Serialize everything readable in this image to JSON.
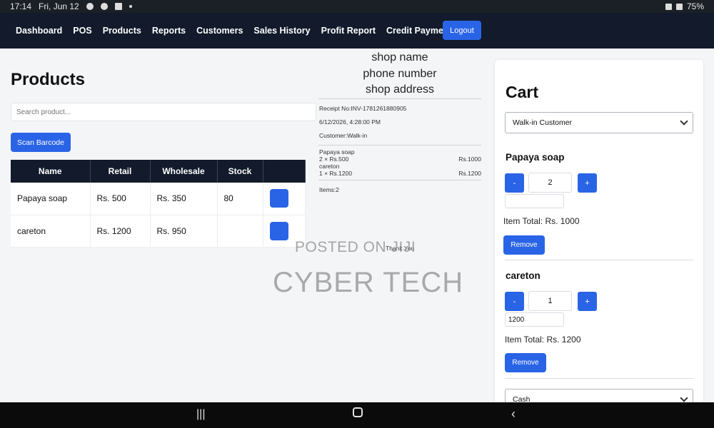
{
  "status_bar": {
    "time": "17:14",
    "date": "Fri, Jun 12",
    "battery": "75%"
  },
  "nav": {
    "items": [
      "Dashboard",
      "POS",
      "Products",
      "Reports",
      "Customers",
      "Sales History",
      "Profit Report",
      "Credit Payments"
    ],
    "logout_label": "Logout"
  },
  "products": {
    "title": "Products",
    "search_placeholder": "Search product...",
    "scan_label": "Scan Barcode",
    "columns": [
      "Name",
      "Retail",
      "Wholesale",
      "Stock"
    ],
    "rows": [
      {
        "name": "Papaya soap",
        "retail": "Rs. 500",
        "wholesale": "Rs. 350",
        "stock": "80"
      },
      {
        "name": "careton",
        "retail": "Rs. 1200",
        "wholesale": "Rs. 950",
        "stock": ""
      }
    ]
  },
  "receipt": {
    "shop_name": "shop name",
    "phone": "phone number",
    "address": "shop address",
    "receipt_no": "Receipt No:INV-1781261880905",
    "datetime": "6/12/2026, 4:28:00 PM",
    "customer": "Customer:Walk-in",
    "lines": [
      {
        "name": "Papaya soap",
        "qty": "2 × Rs.500",
        "amount": "Rs.1000"
      },
      {
        "name": "careton",
        "qty": "1 × Rs.1200",
        "amount": "Rs.1200"
      }
    ],
    "items_count": "Items:2",
    "thank_you": "Thank You"
  },
  "watermark": {
    "line1": "POSTED ON JIJI",
    "line2": "CYBER TECH"
  },
  "cart": {
    "title": "Cart",
    "customer_select": "Walk-in Customer",
    "items": [
      {
        "name": "Papaya soap",
        "qty": "2",
        "price": "",
        "total": "Item Total: Rs. 1000",
        "remove": "Remove"
      },
      {
        "name": "careton",
        "qty": "1",
        "price": "1200",
        "total": "Item Total: Rs. 1200",
        "remove": "Remove"
      }
    ],
    "minus_label": "-",
    "plus_label": "+",
    "payment_select": "Cash"
  }
}
